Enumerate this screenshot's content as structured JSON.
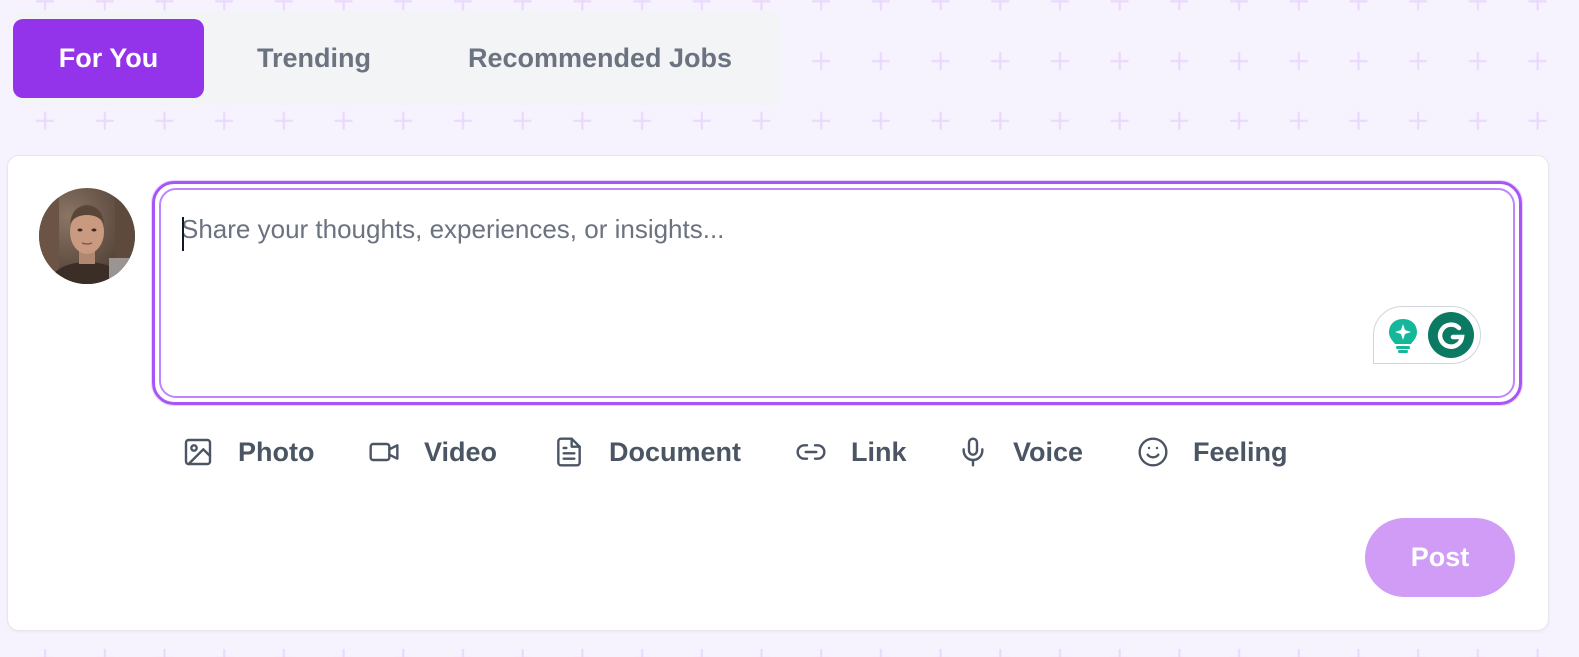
{
  "tabs": [
    {
      "label": "For You",
      "active": true
    },
    {
      "label": "Trending",
      "active": false
    },
    {
      "label": "Recommended Jobs",
      "active": false
    }
  ],
  "composer": {
    "placeholder": "Share your thoughts, experiences, or insights...",
    "value": ""
  },
  "actions": {
    "photo": {
      "label": "Photo",
      "icon": "image-icon"
    },
    "video": {
      "label": "Video",
      "icon": "video-camera-icon"
    },
    "document": {
      "label": "Document",
      "icon": "document-icon"
    },
    "link": {
      "label": "Link",
      "icon": "link-icon"
    },
    "voice": {
      "label": "Voice",
      "icon": "microphone-icon"
    },
    "feeling": {
      "label": "Feeling",
      "icon": "smiley-face-icon"
    }
  },
  "post_button": {
    "label": "Post"
  },
  "colors": {
    "accent": "#9333ea",
    "post_disabled": "#d09cf5",
    "grammarly_green": "#0c7a63",
    "background": "#f7f3fe"
  }
}
